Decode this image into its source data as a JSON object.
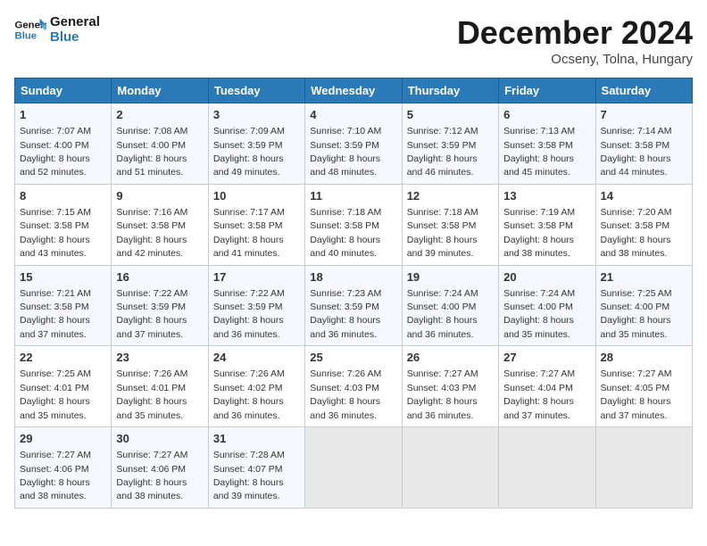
{
  "logo": {
    "line1": "General",
    "line2": "Blue"
  },
  "title": "December 2024",
  "subtitle": "Ocseny, Tolna, Hungary",
  "days_header": [
    "Sunday",
    "Monday",
    "Tuesday",
    "Wednesday",
    "Thursday",
    "Friday",
    "Saturday"
  ],
  "weeks": [
    [
      {
        "day": "1",
        "sunrise": "7:07 AM",
        "sunset": "4:00 PM",
        "daylight": "8 hours and 52 minutes."
      },
      {
        "day": "2",
        "sunrise": "7:08 AM",
        "sunset": "4:00 PM",
        "daylight": "8 hours and 51 minutes."
      },
      {
        "day": "3",
        "sunrise": "7:09 AM",
        "sunset": "3:59 PM",
        "daylight": "8 hours and 49 minutes."
      },
      {
        "day": "4",
        "sunrise": "7:10 AM",
        "sunset": "3:59 PM",
        "daylight": "8 hours and 48 minutes."
      },
      {
        "day": "5",
        "sunrise": "7:12 AM",
        "sunset": "3:59 PM",
        "daylight": "8 hours and 46 minutes."
      },
      {
        "day": "6",
        "sunrise": "7:13 AM",
        "sunset": "3:58 PM",
        "daylight": "8 hours and 45 minutes."
      },
      {
        "day": "7",
        "sunrise": "7:14 AM",
        "sunset": "3:58 PM",
        "daylight": "8 hours and 44 minutes."
      }
    ],
    [
      {
        "day": "8",
        "sunrise": "7:15 AM",
        "sunset": "3:58 PM",
        "daylight": "8 hours and 43 minutes."
      },
      {
        "day": "9",
        "sunrise": "7:16 AM",
        "sunset": "3:58 PM",
        "daylight": "8 hours and 42 minutes."
      },
      {
        "day": "10",
        "sunrise": "7:17 AM",
        "sunset": "3:58 PM",
        "daylight": "8 hours and 41 minutes."
      },
      {
        "day": "11",
        "sunrise": "7:18 AM",
        "sunset": "3:58 PM",
        "daylight": "8 hours and 40 minutes."
      },
      {
        "day": "12",
        "sunrise": "7:18 AM",
        "sunset": "3:58 PM",
        "daylight": "8 hours and 39 minutes."
      },
      {
        "day": "13",
        "sunrise": "7:19 AM",
        "sunset": "3:58 PM",
        "daylight": "8 hours and 38 minutes."
      },
      {
        "day": "14",
        "sunrise": "7:20 AM",
        "sunset": "3:58 PM",
        "daylight": "8 hours and 38 minutes."
      }
    ],
    [
      {
        "day": "15",
        "sunrise": "7:21 AM",
        "sunset": "3:58 PM",
        "daylight": "8 hours and 37 minutes."
      },
      {
        "day": "16",
        "sunrise": "7:22 AM",
        "sunset": "3:59 PM",
        "daylight": "8 hours and 37 minutes."
      },
      {
        "day": "17",
        "sunrise": "7:22 AM",
        "sunset": "3:59 PM",
        "daylight": "8 hours and 36 minutes."
      },
      {
        "day": "18",
        "sunrise": "7:23 AM",
        "sunset": "3:59 PM",
        "daylight": "8 hours and 36 minutes."
      },
      {
        "day": "19",
        "sunrise": "7:24 AM",
        "sunset": "4:00 PM",
        "daylight": "8 hours and 36 minutes."
      },
      {
        "day": "20",
        "sunrise": "7:24 AM",
        "sunset": "4:00 PM",
        "daylight": "8 hours and 35 minutes."
      },
      {
        "day": "21",
        "sunrise": "7:25 AM",
        "sunset": "4:00 PM",
        "daylight": "8 hours and 35 minutes."
      }
    ],
    [
      {
        "day": "22",
        "sunrise": "7:25 AM",
        "sunset": "4:01 PM",
        "daylight": "8 hours and 35 minutes."
      },
      {
        "day": "23",
        "sunrise": "7:26 AM",
        "sunset": "4:01 PM",
        "daylight": "8 hours and 35 minutes."
      },
      {
        "day": "24",
        "sunrise": "7:26 AM",
        "sunset": "4:02 PM",
        "daylight": "8 hours and 36 minutes."
      },
      {
        "day": "25",
        "sunrise": "7:26 AM",
        "sunset": "4:03 PM",
        "daylight": "8 hours and 36 minutes."
      },
      {
        "day": "26",
        "sunrise": "7:27 AM",
        "sunset": "4:03 PM",
        "daylight": "8 hours and 36 minutes."
      },
      {
        "day": "27",
        "sunrise": "7:27 AM",
        "sunset": "4:04 PM",
        "daylight": "8 hours and 37 minutes."
      },
      {
        "day": "28",
        "sunrise": "7:27 AM",
        "sunset": "4:05 PM",
        "daylight": "8 hours and 37 minutes."
      }
    ],
    [
      {
        "day": "29",
        "sunrise": "7:27 AM",
        "sunset": "4:06 PM",
        "daylight": "8 hours and 38 minutes."
      },
      {
        "day": "30",
        "sunrise": "7:27 AM",
        "sunset": "4:06 PM",
        "daylight": "8 hours and 38 minutes."
      },
      {
        "day": "31",
        "sunrise": "7:28 AM",
        "sunset": "4:07 PM",
        "daylight": "8 hours and 39 minutes."
      },
      null,
      null,
      null,
      null
    ]
  ]
}
